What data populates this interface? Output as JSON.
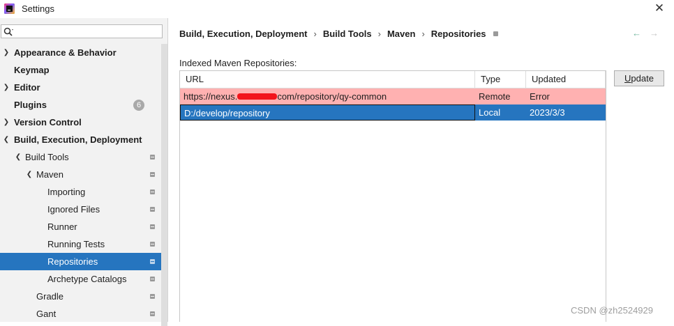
{
  "window": {
    "title": "Settings",
    "close_glyph": "✕"
  },
  "sidebar": {
    "search": {
      "value": "",
      "placeholder": ""
    },
    "items": [
      {
        "label": "Appearance & Behavior",
        "expanded": false,
        "bold": true
      },
      {
        "label": "Keymap",
        "bold": true
      },
      {
        "label": "Editor",
        "expanded": false,
        "bold": true
      },
      {
        "label": "Plugins",
        "bold": true,
        "badge": "6"
      },
      {
        "label": "Version Control",
        "expanded": false,
        "bold": true
      },
      {
        "label": "Build, Execution, Deployment",
        "expanded": true,
        "bold": true
      },
      {
        "label": "Build Tools",
        "expanded": true
      },
      {
        "label": "Maven",
        "expanded": true
      },
      {
        "label": "Importing"
      },
      {
        "label": "Ignored Files"
      },
      {
        "label": "Runner"
      },
      {
        "label": "Running Tests"
      },
      {
        "label": "Repositories",
        "selected": true
      },
      {
        "label": "Archetype Catalogs"
      },
      {
        "label": "Gradle"
      },
      {
        "label": "Gant"
      }
    ]
  },
  "breadcrumb": [
    "Build, Execution, Deployment",
    "Build Tools",
    "Maven",
    "Repositories"
  ],
  "breadcrumb_sep": "›",
  "nav": {
    "back": "←",
    "forward": "→"
  },
  "section_label": "Indexed Maven Repositories:",
  "table": {
    "columns": [
      "URL",
      "Type",
      "Updated"
    ],
    "rows": [
      {
        "url_prefix": "https://nexus.",
        "url_suffix": "com/repository/qy-common",
        "type": "Remote",
        "updated": "Error",
        "status": "error"
      },
      {
        "url": "D:/develop/repository",
        "type": "Local",
        "updated": "2023/3/3",
        "status": "selected"
      }
    ]
  },
  "update_button": {
    "mnemonic": "U",
    "rest": "pdate"
  },
  "watermark": "CSDN @zh2524929",
  "colors": {
    "selection": "#2675bf",
    "error_row": "#ffb1b1",
    "redaction": "#f2141c",
    "sidebar_bg": "#f2f2f2"
  }
}
